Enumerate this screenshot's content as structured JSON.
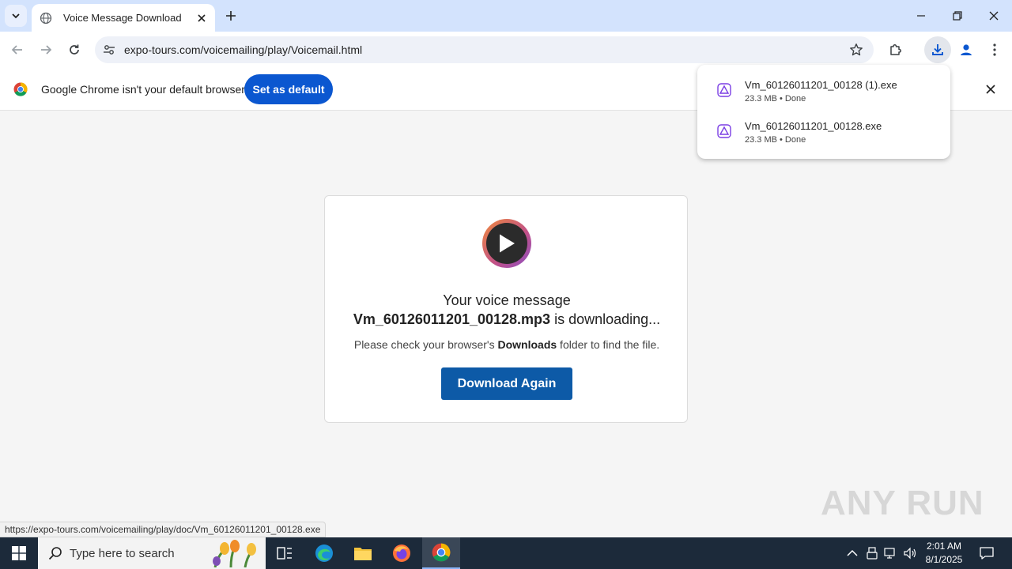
{
  "browser": {
    "tab": {
      "title": "Voice Message Download"
    },
    "address_bar": {
      "url": "expo-tours.com/voicemailing/play/Voicemail.html"
    },
    "infobar": {
      "message": "Google Chrome isn't your default browser",
      "set_default_label": "Set as default"
    },
    "downloads": [
      {
        "name": "Vm_60126011201_00128 (1).exe",
        "status": "23.3 MB • Done"
      },
      {
        "name": "Vm_60126011201_00128.exe",
        "status": "23.3 MB • Done"
      }
    ],
    "status_url": "https://expo-tours.com/voicemailing/play/doc/Vm_60126011201_00128.exe"
  },
  "page": {
    "line1": "Your voice message",
    "file_name": "Vm_60126011201_00128.mp3",
    "downloading_suffix": " is downloading...",
    "instruction_prefix": "Please check your browser's ",
    "instruction_bold": "Downloads",
    "instruction_suffix": " folder to find the file.",
    "download_again_label": "Download Again"
  },
  "watermark": "ANY RUN",
  "taskbar": {
    "search_placeholder": "Type here to search",
    "time": "2:01 AM",
    "date": "8/1/2025"
  },
  "colors": {
    "tabstrip": "#d3e3fd",
    "accent_button": "#0b57d0",
    "download_again": "#0d5aa7",
    "taskbar": "#1c2a3a"
  }
}
